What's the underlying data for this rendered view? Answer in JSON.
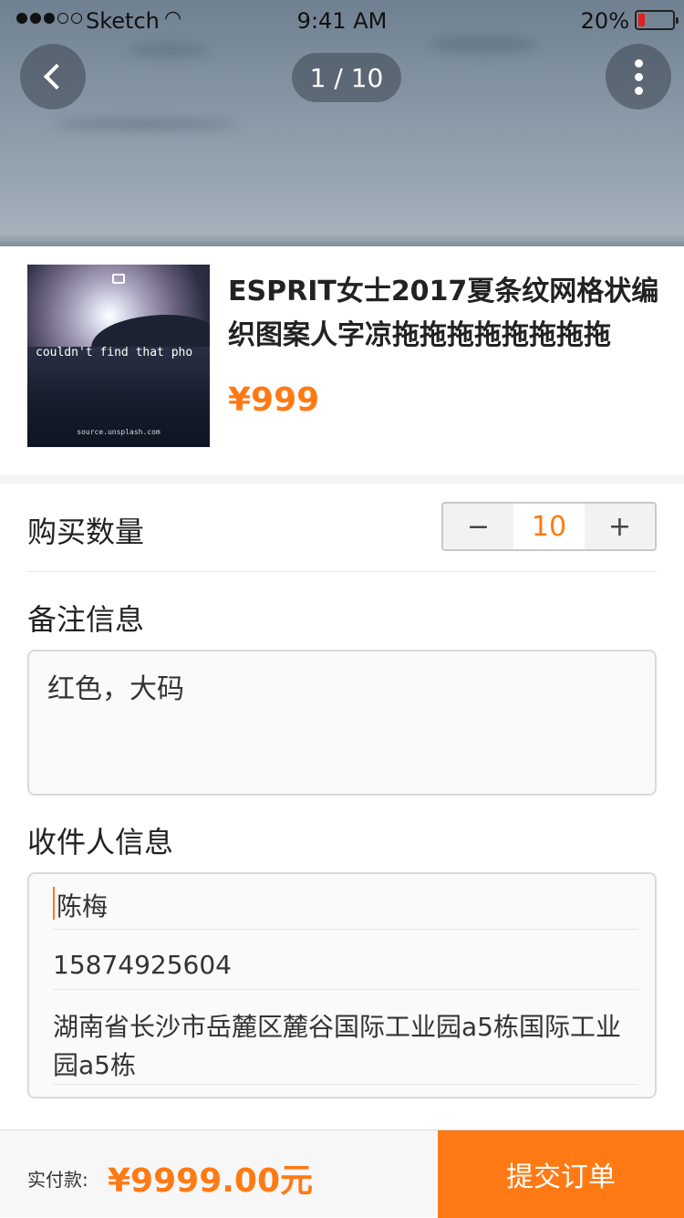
{
  "status_bar": {
    "carrier": "Sketch",
    "time": "9:41 AM",
    "battery": "20%",
    "battery_level": 0.2,
    "signal_bars": 3,
    "signal_total": 5
  },
  "gallery": {
    "page_indicator": "1 / 10"
  },
  "product": {
    "title": "ESPRIT女士2017夏条纹网格状编织图案人字凉拖拖拖拖拖拖拖拖",
    "price": "¥999",
    "thumbnail_text": "couldn't find that pho",
    "thumbnail_source": "source.unsplash.com"
  },
  "quantity": {
    "label": "购买数量",
    "minus": "−",
    "value": "10",
    "plus": "+"
  },
  "note": {
    "label": "备注信息",
    "value": "红色，大码"
  },
  "recipient": {
    "label": "收件人信息",
    "name": "陈梅",
    "phone": "15874925604",
    "address": "湖南省长沙市岳麓区麓谷国际工业园a5栋国际工业园a5栋"
  },
  "footer": {
    "pay_label": "实付款:",
    "pay_amount": "¥9999.00元",
    "submit_label": "提交订单"
  },
  "colors": {
    "accent": "#ff7a14",
    "battery_low": "#e02020"
  },
  "icons": {
    "back": "chevron-left-icon",
    "more": "vertical-dots-icon",
    "wifi": "wifi-icon",
    "battery": "battery-icon",
    "camera": "camera-icon"
  }
}
